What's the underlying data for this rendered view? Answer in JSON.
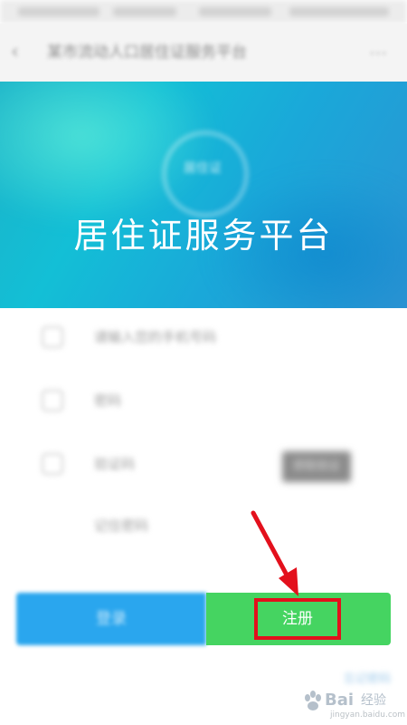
{
  "nav": {
    "back_icon": "back-arrow-icon",
    "title": "某市流动人口居住证服务平台",
    "more_icon": "more-icon"
  },
  "banner": {
    "logo_text": "居住证",
    "title": "居住证服务平台"
  },
  "form": {
    "rows": [
      {
        "icon": "phone-icon",
        "placeholder": "请输入您的手机号码"
      },
      {
        "icon": "lock-icon",
        "placeholder": "密码"
      },
      {
        "icon": "shield-icon",
        "placeholder": "验证码"
      },
      {
        "icon": "",
        "placeholder": "记住密码"
      }
    ],
    "code_button": "获取验证"
  },
  "actions": {
    "login_label": "登录",
    "register_label": "注册"
  },
  "footer": {
    "link_text": "忘记密码"
  },
  "watermark": {
    "brand": "Bai",
    "brand_suffix": "经验",
    "domain": "jingyan.baidu.com"
  },
  "colors": {
    "register_green": "#45d461",
    "login_blue": "#2aa6ee",
    "highlight_red": "#e3101c",
    "banner_teal": "#13bfd6"
  }
}
